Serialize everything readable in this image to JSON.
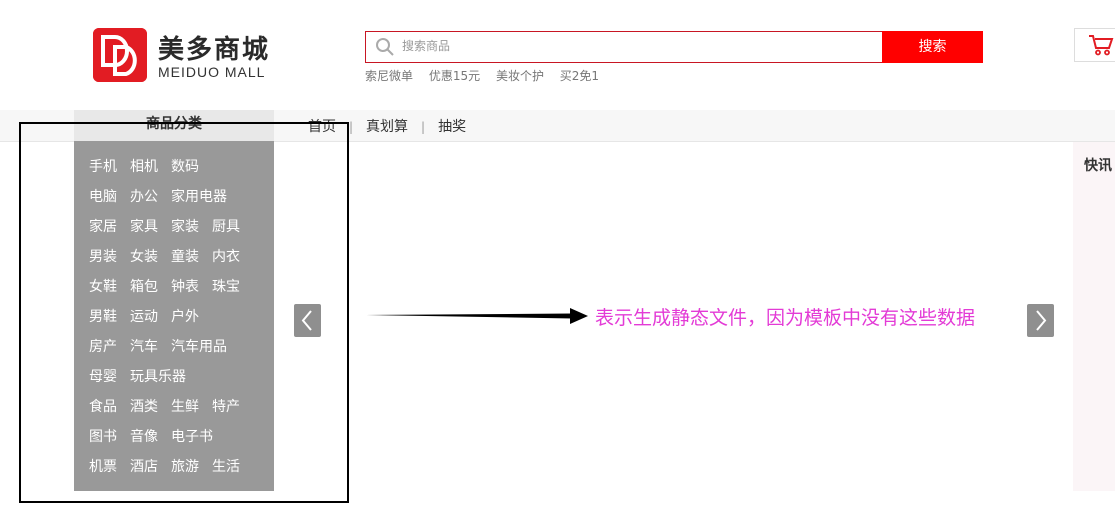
{
  "brand": {
    "name_cn": "美多商城",
    "name_en": "MEIDUO MALL",
    "logo_color": "#e21c23"
  },
  "search": {
    "placeholder": "搜索商品",
    "button_label": "搜索",
    "hot_words": [
      "索尼微单",
      "优惠15元",
      "美妆个护",
      "买2免1"
    ],
    "accent_color": "#ff0000"
  },
  "cart": {
    "icon": "cart-icon"
  },
  "nav": {
    "category_title": "商品分类",
    "links": [
      "首页",
      "真划算",
      "抽奖"
    ],
    "separator": "|"
  },
  "categories": [
    [
      "手机",
      "相机",
      "数码"
    ],
    [
      "电脑",
      "办公",
      "家用电器"
    ],
    [
      "家居",
      "家具",
      "家装",
      "厨具"
    ],
    [
      "男装",
      "女装",
      "童装",
      "内衣"
    ],
    [
      "女鞋",
      "箱包",
      "钟表",
      "珠宝"
    ],
    [
      "男鞋",
      "运动",
      "户外"
    ],
    [
      "房产",
      "汽车",
      "汽车用品"
    ],
    [
      "母婴",
      "玩具乐器"
    ],
    [
      "食品",
      "酒类",
      "生鲜",
      "特产"
    ],
    [
      "图书",
      "音像",
      "电子书"
    ],
    [
      "机票",
      "酒店",
      "旅游",
      "生活"
    ]
  ],
  "slider": {
    "prev_icon": "chevron-left-icon",
    "next_icon": "chevron-right-icon"
  },
  "annotation": {
    "text": "表示生成静态文件，因为模板中没有这些数据",
    "color": "#e33bd6"
  },
  "news": {
    "title": "快讯"
  }
}
